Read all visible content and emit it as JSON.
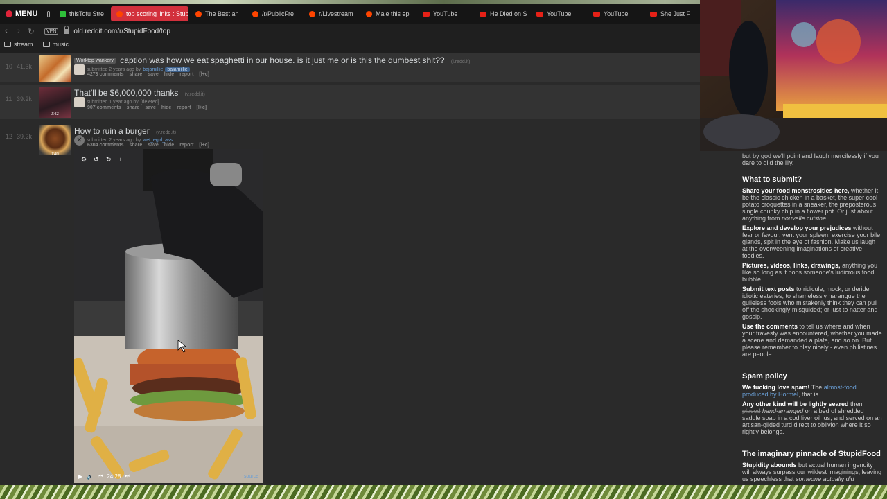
{
  "browser": {
    "menu_label": "MENU",
    "tabs": [
      {
        "label": "thisTofu Stre",
        "type": "twitch"
      },
      {
        "label": "top scoring links : Stup",
        "type": "reddit",
        "active": true
      },
      {
        "label": "The Best an",
        "type": "reddit"
      },
      {
        "label": "/r/PublicFre",
        "type": "reddit"
      },
      {
        "label": "r/Livestream",
        "type": "reddit"
      },
      {
        "label": "Male this ep",
        "type": "reddit"
      },
      {
        "label": "YouTube",
        "type": "yt"
      },
      {
        "label": "He Died on S",
        "type": "yt"
      },
      {
        "label": "YouTube",
        "type": "yt"
      },
      {
        "label": "YouTube",
        "type": "yt"
      },
      {
        "label": "She Just F",
        "type": "yt"
      }
    ],
    "vpn_label": "VPN",
    "url": "old.reddit.com/r/StupidFood/top",
    "bookmarks": [
      "stream",
      "music"
    ]
  },
  "posts": [
    {
      "rank": "10",
      "score": "41.3k",
      "flair": "Worktop wankery",
      "title": "caption was how we eat spaghetti in our house. is it just me or is this the dumbest shit??",
      "domain": "(i.redd.it)",
      "meta_prefix": "submitted 2 years ago by",
      "author": "bajamillie",
      "author_flair": "bajamillie",
      "actions": [
        "4273 comments",
        "share",
        "save",
        "hide",
        "report",
        "[l+c]"
      ]
    },
    {
      "rank": "11",
      "score": "39.2k",
      "title": "That'll be $6,000,000 thanks",
      "domain": "(v.redd.it)",
      "meta_prefix": "submitted 1 year ago by",
      "author": "[deleted]",
      "duration": "0:42",
      "actions": [
        "907 comments",
        "share",
        "save",
        "hide",
        "report",
        "[l+c]"
      ]
    },
    {
      "rank": "12",
      "score": "39.2k",
      "title": "How to ruin a burger",
      "domain": "(v.redd.it)",
      "meta_prefix": "submitted 2 years ago by",
      "author": "wet_egirl_ass",
      "duration": "0:40",
      "actions": [
        "6304 comments",
        "share",
        "save",
        "hide",
        "report",
        "[l+c]"
      ]
    }
  ],
  "video": {
    "time": "24.28",
    "source_label": "source",
    "progress": 0.0
  },
  "sidebar": {
    "intro": "but by god we'll point and laugh mercilessly if you dare to gild the lily.",
    "what_heading": "What to submit?",
    "what_items": [
      {
        "bold": "Share your food monstrosities here,",
        "text": " whether it be the classic chicken in a basket, the super cool potato croquettes in a sneaker, the preposterous single chunky chip in a flower pot. Or just about anything from ",
        "em": "nouvelle cuisine",
        "tail": "."
      },
      {
        "bold": "Explore and develop your prejudices",
        "text": " without fear or favour, vent your spleen, exercise your bile glands, spit in the eye of fashion. Make us laugh at the overweening imaginations of creative foodies."
      },
      {
        "bold": "Pictures, videos, links, drawings,",
        "text": " anything you like so long as it pops someone's ludicrous food bubble."
      },
      {
        "bold": "Submit text posts",
        "text": " to ridicule, mock, or deride idiotic eateries; to shamelessly harangue the guileless fools who mistakenly think they can pull off the shockingly misguided; or just to natter and gossip."
      },
      {
        "bold": "Use the comments",
        "text": " to tell us where and when your travesty was encountered, whether you made a scene and demanded a plate, and so on. But please remember to play nicely - even philistines are people."
      }
    ],
    "spam_heading": "Spam policy",
    "spam_line1_bold": "We fucking love spam!",
    "spam_line1_text": " The ",
    "spam_line1_link": "almost-food produced by Hormel",
    "spam_line1_tail": ", that is.",
    "spam_line2_bold": "Any other kind will be lightly seared",
    "spam_line2_text": " then ",
    "spam_line2_strike": "placed",
    "spam_line2_em": " hand-arranged",
    "spam_line2_tail": " on a bed of shredded saddle soap in a cod liver oil jus, and served on an artisan-gilded turd direct to oblivion where it so rightly belongs.",
    "pinnacle_heading": "The imaginary pinnacle of StupidFood",
    "pinnacle_bold": "Stupidity abounds",
    "pinnacle_text": " but actual human ingenuity will always surpass our wildest imaginings, leaving us speechless that ",
    "pinnacle_em": "someone actually did"
  }
}
